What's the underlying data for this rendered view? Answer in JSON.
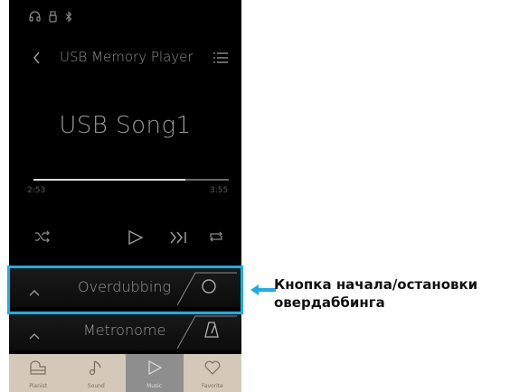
{
  "status_icons": [
    "headphones-icon",
    "usb-icon",
    "bluetooth-icon"
  ],
  "header": {
    "title": "USB Memory Player"
  },
  "player": {
    "song_title": "USB Song1",
    "time_current": "2:53",
    "time_total": "3:55",
    "progress": 0.78
  },
  "panels": {
    "overdubbing_label": "Overdubbing",
    "metronome_label": "Metronome"
  },
  "bottom_nav": {
    "items": [
      {
        "label": "Pianist",
        "icon": "piano-icon",
        "active": false
      },
      {
        "label": "Sound",
        "icon": "music-note-icon",
        "active": false
      },
      {
        "label": "Music",
        "icon": "play-icon",
        "active": true
      },
      {
        "label": "Favorite",
        "icon": "heart-icon",
        "active": false
      }
    ]
  },
  "annotation": {
    "callout_text": "Кнопка начала/остановки овердаббинга",
    "color": "#1aaee6"
  }
}
